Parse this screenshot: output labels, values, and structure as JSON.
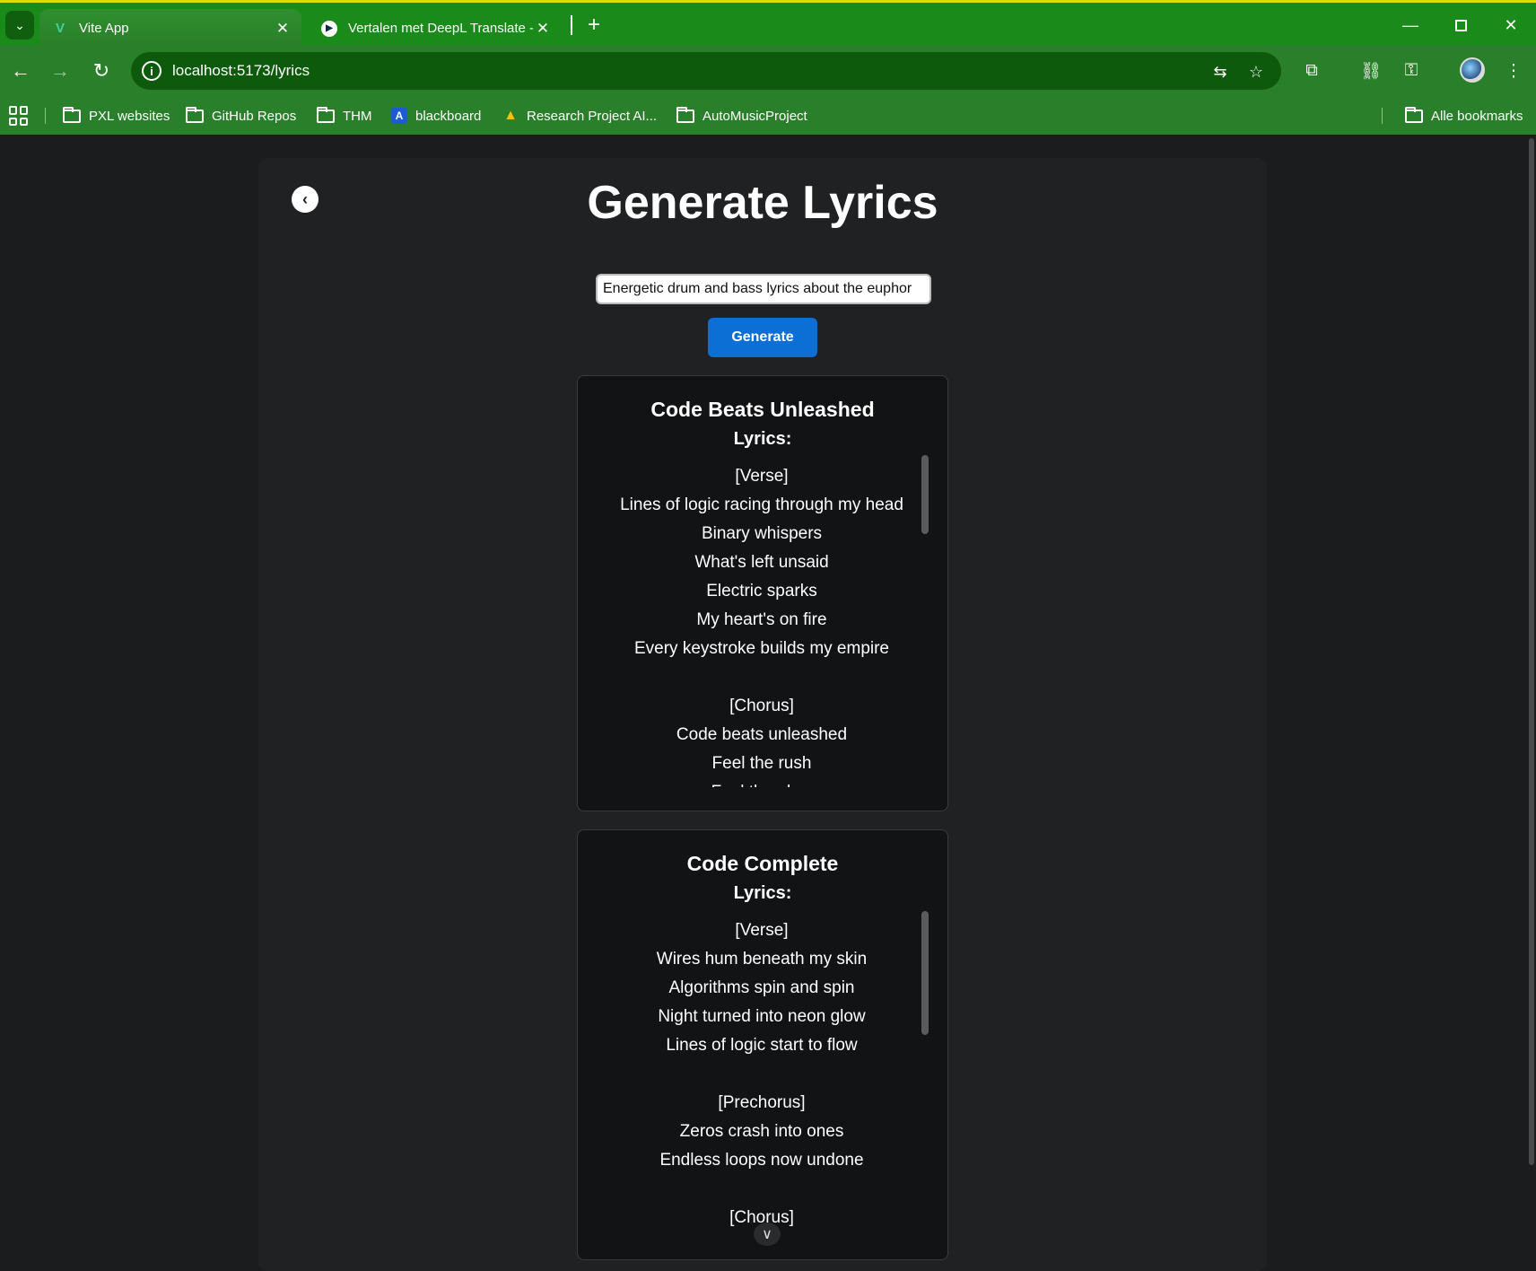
{
  "browser": {
    "tabs": [
      {
        "title": "Vite App",
        "active": true
      },
      {
        "title": "Vertalen met DeepL Translate - ",
        "active": false
      }
    ],
    "url": "localhost:5173/lyrics",
    "bookmarks": [
      {
        "label": "PXL websites",
        "type": "folder"
      },
      {
        "label": "GitHub Repos",
        "type": "folder"
      },
      {
        "label": "THM",
        "type": "folder"
      },
      {
        "label": "blackboard",
        "type": "site"
      },
      {
        "label": "Research Project AI...",
        "type": "site"
      },
      {
        "label": "AutoMusicProject",
        "type": "folder"
      }
    ],
    "all_bookmarks_label": "Alle bookmarks",
    "theme_color": "#2a7f2a"
  },
  "page": {
    "title": "Generate Lyrics",
    "prompt_value": "Energetic drum and bass lyrics about the euphor",
    "generate_label": "Generate",
    "accent_color": "#0b6fd6"
  },
  "songs": [
    {
      "title": "Code Beats Unleashed",
      "subtitle": "Lyrics:",
      "lines": [
        "[Verse]",
        "Lines of logic racing through my head",
        "Binary whispers",
        "What's left unsaid",
        "Electric sparks",
        "My heart's on fire",
        "Every keystroke builds my empire",
        "",
        "[Chorus]",
        "Code beats unleashed",
        "Feel the rush",
        "Feel the glow"
      ]
    },
    {
      "title": "Code Complete",
      "subtitle": "Lyrics:",
      "lines": [
        "[Verse]",
        "Wires hum beneath my skin",
        "Algorithms spin and spin",
        "Night turned into neon glow",
        "Lines of logic start to flow",
        "",
        "[Prechorus]",
        "Zeros crash into ones",
        "Endless loops now undone",
        "",
        "[Chorus]"
      ]
    }
  ]
}
